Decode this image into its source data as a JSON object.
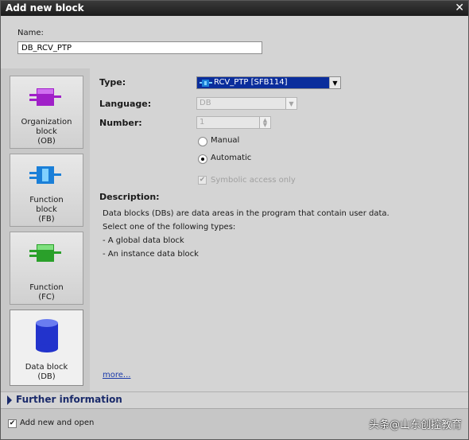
{
  "window": {
    "title": "Add new block",
    "close_glyph": "✕"
  },
  "name_field": {
    "label": "Name:",
    "value": "DB_RCV_PTP"
  },
  "block_types": [
    {
      "id": "ob",
      "line1": "Organization",
      "line2": "block",
      "line3": "(OB)",
      "icon": "organization-block-icon",
      "color": "#a020c8"
    },
    {
      "id": "fb",
      "line1": "Function",
      "line2": "block",
      "line3": "(FB)",
      "icon": "function-block-icon",
      "color": "#1a7fd8"
    },
    {
      "id": "fc",
      "line1": "Function",
      "line2": "(FC)",
      "icon": "function-icon",
      "color": "#2aa02a"
    },
    {
      "id": "db",
      "line1": "Data block",
      "line2": "(DB)",
      "icon": "data-block-icon",
      "color": "#2233cc",
      "selected": true
    }
  ],
  "form": {
    "type_label": "Type:",
    "type_value": "RCV_PTP  [SFB114]",
    "language_label": "Language:",
    "language_value": "DB",
    "number_label": "Number:",
    "number_value": "1",
    "manual_label": "Manual",
    "automatic_label": "Automatic",
    "number_mode": "Automatic",
    "symbolic_label": "Symbolic access only",
    "symbolic_checked": true
  },
  "description": {
    "heading": "Description:",
    "lines": [
      "Data blocks (DBs) are data areas in the program that contain user data.",
      "Select one of the following types:",
      "- A global data block",
      "- An instance data block"
    ],
    "more_link": "more..."
  },
  "further_info": {
    "label": "Further information"
  },
  "footer": {
    "add_open_label": "Add new and open",
    "add_open_checked": true
  },
  "watermark": "头条@山东创控教育",
  "colors": {
    "title_bar": "#2a2a2a",
    "selection": "#0a2d9c",
    "dialog_bg": "#d4d4d4"
  }
}
